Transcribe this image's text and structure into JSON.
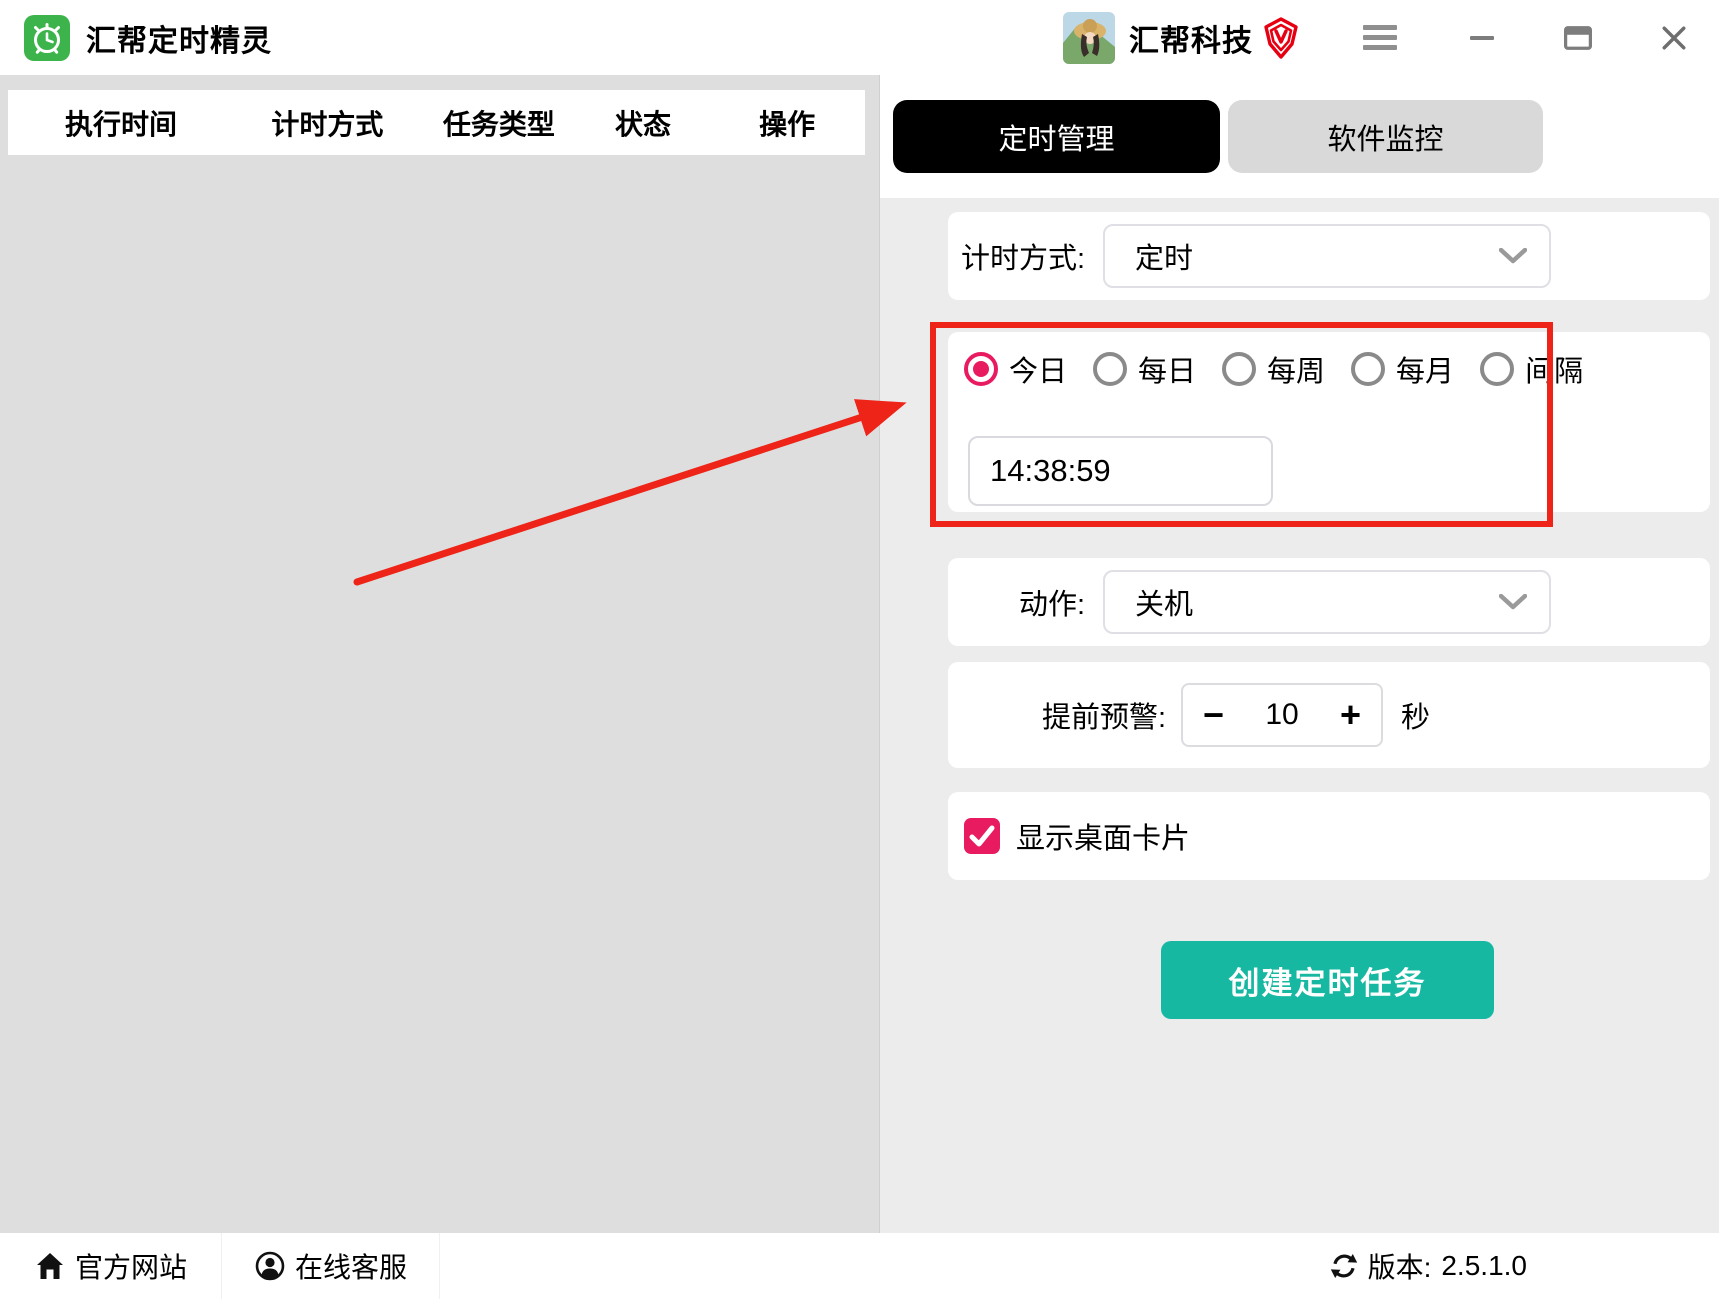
{
  "titlebar": {
    "app_title": "汇帮定时精灵",
    "brand": "汇帮科技"
  },
  "table": {
    "columns": [
      "执行时间",
      "计时方式",
      "任务类型",
      "状态",
      "操作"
    ]
  },
  "tabs": {
    "timer": "定时管理",
    "monitor": "软件监控"
  },
  "form": {
    "timing_label": "计时方式:",
    "timing_value": "定时",
    "schedule": {
      "options": [
        {
          "label": "今日",
          "selected": true
        },
        {
          "label": "每日",
          "selected": false
        },
        {
          "label": "每周",
          "selected": false
        },
        {
          "label": "每月",
          "selected": false
        },
        {
          "label": "间隔",
          "selected": false
        }
      ],
      "time_value": "14:38:59"
    },
    "action_label": "动作:",
    "action_value": "关机",
    "warning_label": "提前预警:",
    "warning_minus": "−",
    "warning_value": "10",
    "warning_plus": "+",
    "warning_unit": "秒",
    "desktop_card_label": "显示桌面卡片",
    "desktop_card_checked": true,
    "create_button": "创建定时任务"
  },
  "footer": {
    "website": "官方网站",
    "support": "在线客服",
    "version_label": "版本:",
    "version_value": "2.5.1.0"
  },
  "colors": {
    "accent_pink": "#e81b61",
    "button_teal": "#16b8a2",
    "annotation_red": "#ee2418",
    "app_green": "#3cb44b",
    "badge_red": "#e60012"
  }
}
